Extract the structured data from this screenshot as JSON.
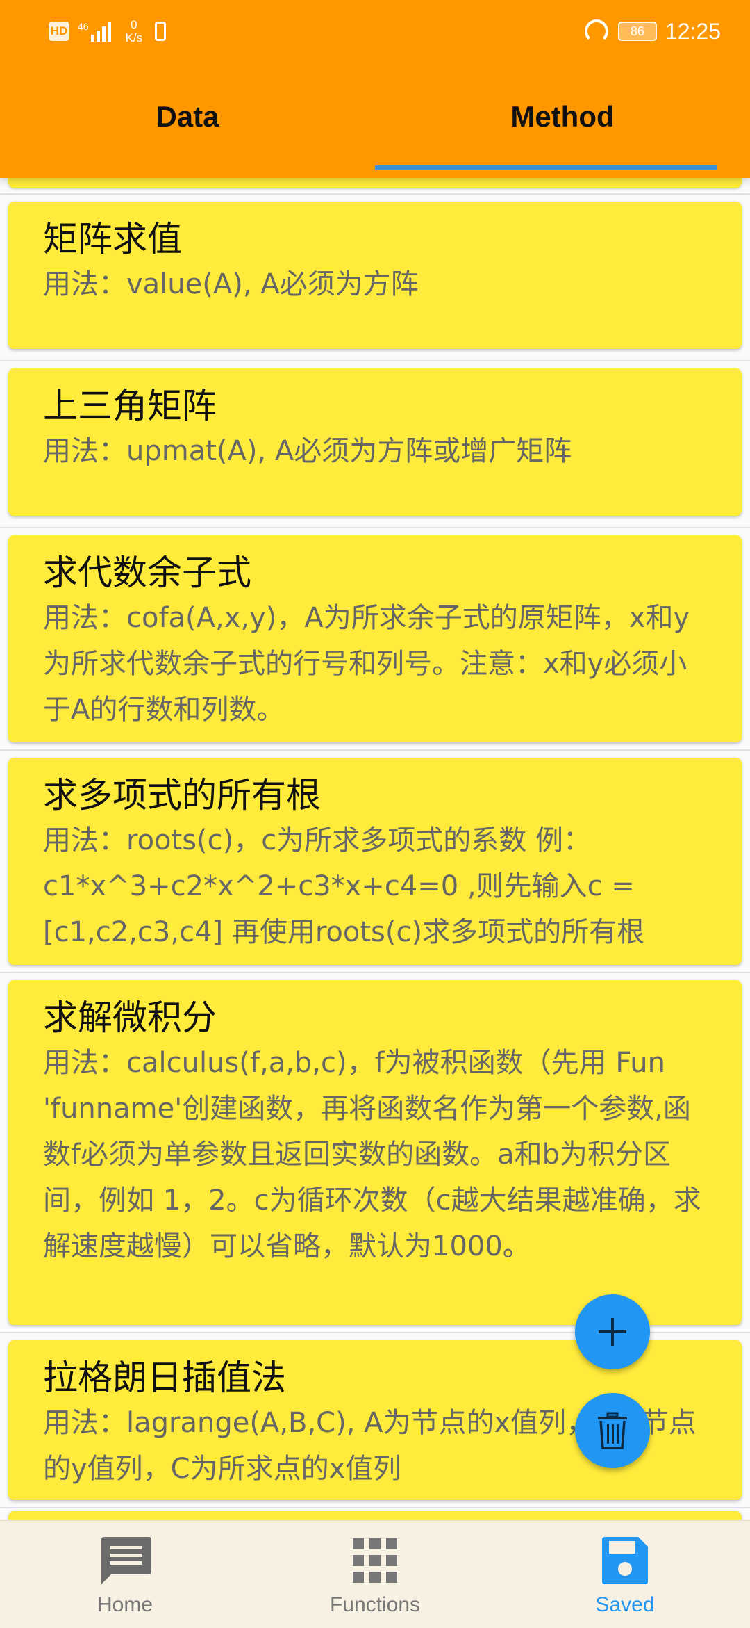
{
  "status_bar": {
    "hd": "HD",
    "network": "46",
    "speed_value": "0",
    "speed_unit": "K/s",
    "battery": "86",
    "time": "12:25"
  },
  "tabs": [
    {
      "label": "Data",
      "selected": false
    },
    {
      "label": "Method",
      "selected": true
    }
  ],
  "methods": [
    {
      "title": "矩阵求值",
      "desc": "用法：value(A), A必须为方阵"
    },
    {
      "title": "上三角矩阵",
      "desc": "用法：upmat(A), A必须为方阵或增广矩阵"
    },
    {
      "title": "求代数余子式",
      "desc": "用法：cofa(A,x,y)，A为所求余子式的原矩阵，x和y为所求代数余子式的行号和列号。注意：x和y必须小于A的行数和列数。"
    },
    {
      "title": "求多项式的所有根",
      "desc": "用法：roots(c)，c为所求多项式的系数 例：c1*x^3+c2*x^2+c3*x+c4=0 ,则先输入c = [c1,c2,c3,c4] 再使用roots(c)求多项式的所有根"
    },
    {
      "title": "求解微积分",
      "desc": "用法：calculus(f,a,b,c)，f为被积函数（先用 Fun 'funname'创建函数，再将函数名作为第一个参数,函数f必须为单参数且返回实数的函数。a和b为积分区间，例如 1，2。c为循环次数（c越大结果越准确，求解速度越慢）可以省略，默认为1000。"
    },
    {
      "title": "拉格朗日插值法",
      "desc": "用法：lagrange(A,B,C), A为节点的x值列，B为节点的y值列，C为所求点的x值列"
    }
  ],
  "fabs": {
    "add_icon": "plus-icon",
    "delete_icon": "trash-icon"
  },
  "bottom_nav": [
    {
      "label": "Home",
      "icon": "message-icon",
      "active": false
    },
    {
      "label": "Functions",
      "icon": "grid-icon",
      "active": false
    },
    {
      "label": "Saved",
      "icon": "save-icon",
      "active": true
    }
  ],
  "colors": {
    "app_bar": "#ff9800",
    "card": "#ffeb3b",
    "accent": "#2196f3",
    "tab_indicator": "#3d8fd6"
  }
}
